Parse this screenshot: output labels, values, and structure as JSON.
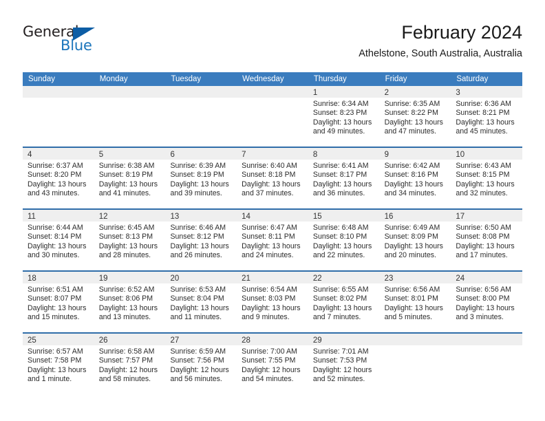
{
  "brand": {
    "name_top": "General",
    "name_bottom": "Blue",
    "accent_color": "#1b75bb",
    "triangle_color": "#0c5da5"
  },
  "header": {
    "title": "February 2024",
    "location": "Athelstone, South Australia, Australia"
  },
  "theme": {
    "header_row_bg": "#3a7cbe",
    "week_divider": "#2f6da9",
    "day_strip_bg": "#efefef",
    "cell_bg": "#ffffff",
    "text": "#2b2b2b"
  },
  "weekdays": [
    "Sunday",
    "Monday",
    "Tuesday",
    "Wednesday",
    "Thursday",
    "Friday",
    "Saturday"
  ],
  "weeks": [
    [
      {
        "day": "",
        "empty": true
      },
      {
        "day": "",
        "empty": true
      },
      {
        "day": "",
        "empty": true
      },
      {
        "day": "",
        "empty": true
      },
      {
        "day": "1",
        "sunrise": "Sunrise: 6:34 AM",
        "sunset": "Sunset: 8:23 PM",
        "daylight_1": "Daylight: 13 hours",
        "daylight_2": "and 49 minutes."
      },
      {
        "day": "2",
        "sunrise": "Sunrise: 6:35 AM",
        "sunset": "Sunset: 8:22 PM",
        "daylight_1": "Daylight: 13 hours",
        "daylight_2": "and 47 minutes."
      },
      {
        "day": "3",
        "sunrise": "Sunrise: 6:36 AM",
        "sunset": "Sunset: 8:21 PM",
        "daylight_1": "Daylight: 13 hours",
        "daylight_2": "and 45 minutes."
      }
    ],
    [
      {
        "day": "4",
        "sunrise": "Sunrise: 6:37 AM",
        "sunset": "Sunset: 8:20 PM",
        "daylight_1": "Daylight: 13 hours",
        "daylight_2": "and 43 minutes."
      },
      {
        "day": "5",
        "sunrise": "Sunrise: 6:38 AM",
        "sunset": "Sunset: 8:19 PM",
        "daylight_1": "Daylight: 13 hours",
        "daylight_2": "and 41 minutes."
      },
      {
        "day": "6",
        "sunrise": "Sunrise: 6:39 AM",
        "sunset": "Sunset: 8:19 PM",
        "daylight_1": "Daylight: 13 hours",
        "daylight_2": "and 39 minutes."
      },
      {
        "day": "7",
        "sunrise": "Sunrise: 6:40 AM",
        "sunset": "Sunset: 8:18 PM",
        "daylight_1": "Daylight: 13 hours",
        "daylight_2": "and 37 minutes."
      },
      {
        "day": "8",
        "sunrise": "Sunrise: 6:41 AM",
        "sunset": "Sunset: 8:17 PM",
        "daylight_1": "Daylight: 13 hours",
        "daylight_2": "and 36 minutes."
      },
      {
        "day": "9",
        "sunrise": "Sunrise: 6:42 AM",
        "sunset": "Sunset: 8:16 PM",
        "daylight_1": "Daylight: 13 hours",
        "daylight_2": "and 34 minutes."
      },
      {
        "day": "10",
        "sunrise": "Sunrise: 6:43 AM",
        "sunset": "Sunset: 8:15 PM",
        "daylight_1": "Daylight: 13 hours",
        "daylight_2": "and 32 minutes."
      }
    ],
    [
      {
        "day": "11",
        "sunrise": "Sunrise: 6:44 AM",
        "sunset": "Sunset: 8:14 PM",
        "daylight_1": "Daylight: 13 hours",
        "daylight_2": "and 30 minutes."
      },
      {
        "day": "12",
        "sunrise": "Sunrise: 6:45 AM",
        "sunset": "Sunset: 8:13 PM",
        "daylight_1": "Daylight: 13 hours",
        "daylight_2": "and 28 minutes."
      },
      {
        "day": "13",
        "sunrise": "Sunrise: 6:46 AM",
        "sunset": "Sunset: 8:12 PM",
        "daylight_1": "Daylight: 13 hours",
        "daylight_2": "and 26 minutes."
      },
      {
        "day": "14",
        "sunrise": "Sunrise: 6:47 AM",
        "sunset": "Sunset: 8:11 PM",
        "daylight_1": "Daylight: 13 hours",
        "daylight_2": "and 24 minutes."
      },
      {
        "day": "15",
        "sunrise": "Sunrise: 6:48 AM",
        "sunset": "Sunset: 8:10 PM",
        "daylight_1": "Daylight: 13 hours",
        "daylight_2": "and 22 minutes."
      },
      {
        "day": "16",
        "sunrise": "Sunrise: 6:49 AM",
        "sunset": "Sunset: 8:09 PM",
        "daylight_1": "Daylight: 13 hours",
        "daylight_2": "and 20 minutes."
      },
      {
        "day": "17",
        "sunrise": "Sunrise: 6:50 AM",
        "sunset": "Sunset: 8:08 PM",
        "daylight_1": "Daylight: 13 hours",
        "daylight_2": "and 17 minutes."
      }
    ],
    [
      {
        "day": "18",
        "sunrise": "Sunrise: 6:51 AM",
        "sunset": "Sunset: 8:07 PM",
        "daylight_1": "Daylight: 13 hours",
        "daylight_2": "and 15 minutes."
      },
      {
        "day": "19",
        "sunrise": "Sunrise: 6:52 AM",
        "sunset": "Sunset: 8:06 PM",
        "daylight_1": "Daylight: 13 hours",
        "daylight_2": "and 13 minutes."
      },
      {
        "day": "20",
        "sunrise": "Sunrise: 6:53 AM",
        "sunset": "Sunset: 8:04 PM",
        "daylight_1": "Daylight: 13 hours",
        "daylight_2": "and 11 minutes."
      },
      {
        "day": "21",
        "sunrise": "Sunrise: 6:54 AM",
        "sunset": "Sunset: 8:03 PM",
        "daylight_1": "Daylight: 13 hours",
        "daylight_2": "and 9 minutes."
      },
      {
        "day": "22",
        "sunrise": "Sunrise: 6:55 AM",
        "sunset": "Sunset: 8:02 PM",
        "daylight_1": "Daylight: 13 hours",
        "daylight_2": "and 7 minutes."
      },
      {
        "day": "23",
        "sunrise": "Sunrise: 6:56 AM",
        "sunset": "Sunset: 8:01 PM",
        "daylight_1": "Daylight: 13 hours",
        "daylight_2": "and 5 minutes."
      },
      {
        "day": "24",
        "sunrise": "Sunrise: 6:56 AM",
        "sunset": "Sunset: 8:00 PM",
        "daylight_1": "Daylight: 13 hours",
        "daylight_2": "and 3 minutes."
      }
    ],
    [
      {
        "day": "25",
        "sunrise": "Sunrise: 6:57 AM",
        "sunset": "Sunset: 7:58 PM",
        "daylight_1": "Daylight: 13 hours",
        "daylight_2": "and 1 minute."
      },
      {
        "day": "26",
        "sunrise": "Sunrise: 6:58 AM",
        "sunset": "Sunset: 7:57 PM",
        "daylight_1": "Daylight: 12 hours",
        "daylight_2": "and 58 minutes."
      },
      {
        "day": "27",
        "sunrise": "Sunrise: 6:59 AM",
        "sunset": "Sunset: 7:56 PM",
        "daylight_1": "Daylight: 12 hours",
        "daylight_2": "and 56 minutes."
      },
      {
        "day": "28",
        "sunrise": "Sunrise: 7:00 AM",
        "sunset": "Sunset: 7:55 PM",
        "daylight_1": "Daylight: 12 hours",
        "daylight_2": "and 54 minutes."
      },
      {
        "day": "29",
        "sunrise": "Sunrise: 7:01 AM",
        "sunset": "Sunset: 7:53 PM",
        "daylight_1": "Daylight: 12 hours",
        "daylight_2": "and 52 minutes."
      },
      {
        "day": "",
        "empty": true
      },
      {
        "day": "",
        "empty": true
      }
    ]
  ]
}
